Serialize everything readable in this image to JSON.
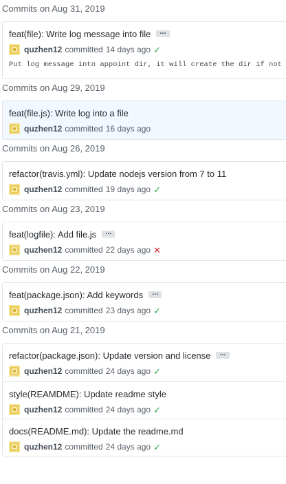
{
  "groups": [
    {
      "header": "Commits on Aug 31, 2019",
      "commits": [
        {
          "title": "feat(file): Write log message into file",
          "has_ellipsis": true,
          "ellipsis_label": "...",
          "author": "quzhen12",
          "committed_label": "committed",
          "time": "14 days ago",
          "status": "success",
          "body": "Put log message into appoint dir, it will create the dir if not"
        }
      ]
    },
    {
      "header": "Commits on Aug 29, 2019",
      "commits": [
        {
          "title": "feat(file.js): Write log into a file",
          "has_ellipsis": false,
          "author": "quzhen12",
          "committed_label": "committed",
          "time": "16 days ago",
          "status": "none",
          "highlight": true
        }
      ]
    },
    {
      "header": "Commits on Aug 26, 2019",
      "commits": [
        {
          "title": "refactor(travis.yml): Update nodejs version from 7 to 11",
          "has_ellipsis": false,
          "author": "quzhen12",
          "committed_label": "committed",
          "time": "19 days ago",
          "status": "success"
        }
      ]
    },
    {
      "header": "Commits on Aug 23, 2019",
      "commits": [
        {
          "title": "feat(logfile): Add file.js",
          "has_ellipsis": true,
          "ellipsis_label": "...",
          "author": "quzhen12",
          "committed_label": "committed",
          "time": "22 days ago",
          "status": "failure"
        }
      ]
    },
    {
      "header": "Commits on Aug 22, 2019",
      "commits": [
        {
          "title": "feat(package.json): Add keywords",
          "has_ellipsis": true,
          "ellipsis_label": "...",
          "author": "quzhen12",
          "committed_label": "committed",
          "time": "23 days ago",
          "status": "success"
        }
      ]
    },
    {
      "header": "Commits on Aug 21, 2019",
      "commits": [
        {
          "title": "refactor(package.json): Update version and license",
          "has_ellipsis": true,
          "ellipsis_label": "...",
          "author": "quzhen12",
          "committed_label": "committed",
          "time": "24 days ago",
          "status": "success"
        },
        {
          "title": "style(REAMDME): Update readme style",
          "has_ellipsis": false,
          "author": "quzhen12",
          "committed_label": "committed",
          "time": "24 days ago",
          "status": "success"
        },
        {
          "title": "docs(README.md): Update the readme.md",
          "has_ellipsis": false,
          "author": "quzhen12",
          "committed_label": "committed",
          "time": "24 days ago",
          "status": "success"
        }
      ]
    }
  ],
  "icons": {
    "success": "check-icon",
    "failure": "x-icon",
    "avatar": "identicon-avatar"
  },
  "colors": {
    "success": "#28a745",
    "failure": "#cb2431",
    "highlight_bg": "#f1f8ff"
  }
}
